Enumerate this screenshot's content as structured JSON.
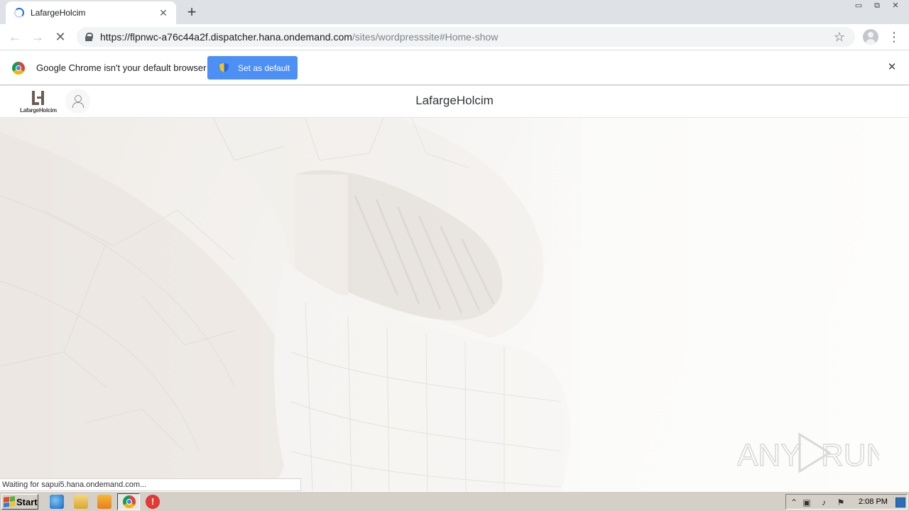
{
  "browser": {
    "tab_title": "LafargeHolcim",
    "tab_close_icon": "close-icon",
    "new_tab_label": "+",
    "url_host": "https://flpnwc-a76c44a2f.dispatcher.hana.ondemand.com",
    "url_path": "/sites/wordpresssite#Home-show",
    "window_controls": [
      "minimize",
      "restore",
      "close"
    ]
  },
  "infobar": {
    "message": "Google Chrome isn't your default browser",
    "button_label": "Set as default"
  },
  "app": {
    "logo_text": "LafargeHolcim",
    "title": "LafargeHolcim"
  },
  "status": {
    "text": "Waiting for sapui5.hana.ondemand.com..."
  },
  "watermark": {
    "text_left": "ANY",
    "text_right": "RUN"
  },
  "taskbar": {
    "start_label": "Start",
    "clock": "2:08 PM",
    "quick_launch": [
      "ie-icon",
      "explorer-icon",
      "media-player-icon",
      "chrome-icon",
      "stop-icon"
    ]
  }
}
